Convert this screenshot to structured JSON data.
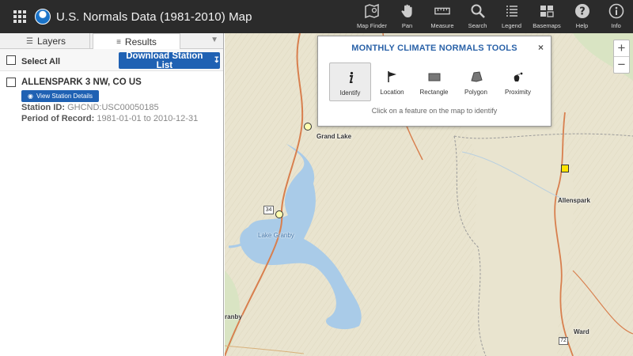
{
  "header": {
    "title": "U.S. Normals Data (1981-2010) Map",
    "logo": "noaa-logo",
    "tools": [
      {
        "label": "Map Finder",
        "icon": "map-finder-icon"
      },
      {
        "label": "Pan",
        "icon": "hand-icon"
      },
      {
        "label": "Measure",
        "icon": "ruler-icon"
      },
      {
        "label": "Search",
        "icon": "search-icon"
      },
      {
        "label": "Legend",
        "icon": "list-icon"
      },
      {
        "label": "Basemaps",
        "icon": "basemaps-icon"
      },
      {
        "label": "Help",
        "icon": "help-icon"
      },
      {
        "label": "Info",
        "icon": "info-icon"
      }
    ]
  },
  "sidebar": {
    "tabs": [
      {
        "label": "Layers",
        "icon": "layers-icon"
      },
      {
        "label": "Results",
        "icon": "list-icon",
        "active": true
      }
    ],
    "select_all_label": "Select All",
    "download_label": "Download Station List",
    "station": {
      "name": "ALLENSPARK 3 NW, CO US",
      "details_label": "View Station Details",
      "id_label": "Station ID:",
      "id_value": "GHCND:USC00050185",
      "period_label": "Period of Record:",
      "period_value": "1981-01-01 to 2010-12-31"
    }
  },
  "map": {
    "labels": {
      "grand_lake": "Grand Lake",
      "lake_granby": "Lake Granby",
      "allenspark": "Allenspark",
      "ward": "Ward",
      "granby": "ranby",
      "hwy34": "34",
      "hwy72": "72"
    },
    "zoom_in": "+",
    "zoom_out": "−",
    "colors": {
      "water": "#a9cbe8",
      "road": "#d87f4e",
      "terrain": "#e9e4cf",
      "station_selected": "#ffe300"
    }
  },
  "tools_panel": {
    "title": "MONTHLY CLIMATE NORMALS TOOLS",
    "close": "×",
    "tools": [
      {
        "label": "Identify",
        "icon": "info-italic-icon",
        "active": true
      },
      {
        "label": "Location",
        "icon": "flag-icon"
      },
      {
        "label": "Rectangle",
        "icon": "rectangle-icon"
      },
      {
        "label": "Polygon",
        "icon": "polygon-icon"
      },
      {
        "label": "Proximity",
        "icon": "proximity-icon"
      }
    ],
    "hint": "Click on a feature on the map to identify"
  }
}
